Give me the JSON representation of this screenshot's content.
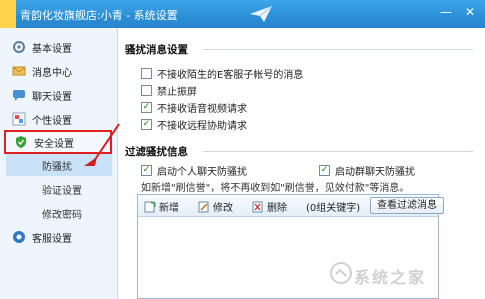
{
  "window": {
    "title": "青韵化妆旗舰店:小青 - 系统设置",
    "minimize_glyph": "—",
    "close_glyph": "✕"
  },
  "sidebar": {
    "items": [
      {
        "label": "基本设置",
        "icon": "gear-icon"
      },
      {
        "label": "消息中心",
        "icon": "envelope-icon"
      },
      {
        "label": "聊天设置",
        "icon": "chat-icon"
      },
      {
        "label": "个性设置",
        "icon": "palette-icon"
      },
      {
        "label": "安全设置",
        "icon": "shield-icon",
        "active": true
      },
      {
        "label": "客服设置",
        "icon": "headset-icon"
      }
    ],
    "sub_items": [
      {
        "label": "防骚扰",
        "selected": true
      },
      {
        "label": "验证设置"
      },
      {
        "label": "修改密码"
      }
    ]
  },
  "main": {
    "section1": {
      "title": "骚扰消息设置",
      "options": [
        {
          "label": "不接收陌生的E客服子帐号的消息",
          "checked": false
        },
        {
          "label": "禁止振屏",
          "checked": false
        },
        {
          "label": "不接收语音视频请求",
          "checked": true
        },
        {
          "label": "不接收远程协助请求",
          "checked": true
        }
      ]
    },
    "section2": {
      "title": "过滤骚扰信息",
      "options": [
        {
          "label": "启动个人聊天防骚扰",
          "checked": true
        },
        {
          "label": "启动群聊天防骚扰",
          "checked": true
        }
      ],
      "hint": "如新增\"刷信誉\"，将不再收到如\"刷信誉，见效付款\"等消息。",
      "toolbar": {
        "add_label": "新增",
        "edit_label": "修改",
        "delete_label": "删除",
        "count_label": "(0组关键字)",
        "view_button": "查看过滤消息"
      }
    }
  },
  "watermark": {
    "text": "系统之家"
  },
  "colors": {
    "titlebar": "#2b8fd6",
    "sidebar_bg": "#eef5fc",
    "highlight_border": "#e02020",
    "selected_bg": "#c9e2f8",
    "arrow": "#d42020"
  }
}
